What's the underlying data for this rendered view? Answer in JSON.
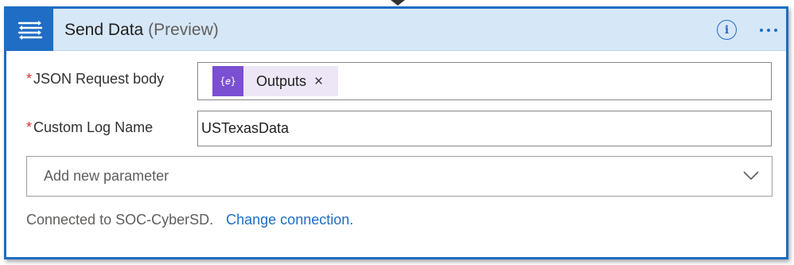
{
  "header": {
    "title": "Send Data",
    "subtitle": "(Preview)",
    "icon": "data-collector-icon",
    "accent_color": "#1f6dc5",
    "header_bg": "#d6e7f7"
  },
  "fields": {
    "json_body": {
      "required_mark": "*",
      "label": "JSON Request body",
      "token": {
        "icon": "expression-icon",
        "icon_text": "{𝑒}",
        "label": "Outputs",
        "remove_symbol": "×",
        "color": "#7b4fd1"
      }
    },
    "custom_log": {
      "required_mark": "*",
      "label": "Custom Log Name",
      "value": "USTexasData"
    }
  },
  "add_parameter": {
    "placeholder": "Add new parameter"
  },
  "footer": {
    "connected_text": "Connected to SOC-CyberSD.",
    "change_link": "Change connection."
  }
}
